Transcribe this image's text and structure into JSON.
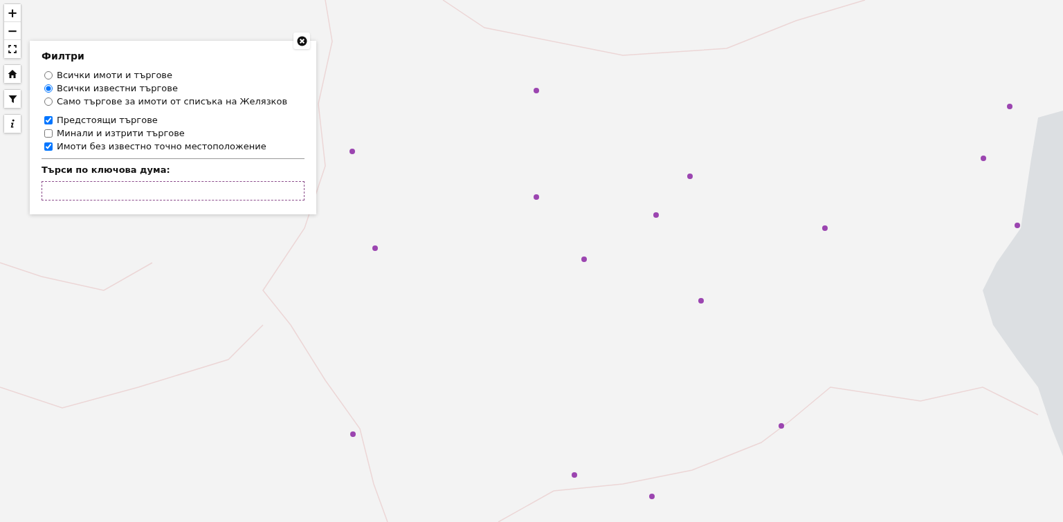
{
  "map_controls": [
    {
      "kind": "zoom_in",
      "label": "+"
    },
    {
      "kind": "zoom_out",
      "label": "−"
    },
    {
      "kind": "fullscreen"
    },
    {
      "kind": "home"
    },
    {
      "kind": "filter"
    },
    {
      "kind": "info"
    }
  ],
  "filter_panel": {
    "title": "Филтри",
    "scope_options": [
      {
        "label": "Всички имоти и търгове",
        "selected": false
      },
      {
        "label": "Всички известни търгове",
        "selected": true
      },
      {
        "label": "Само търгове за имоти от списъка на Желязков",
        "selected": false
      }
    ],
    "toggles": [
      {
        "label": "Предстоящи търгове",
        "checked": true
      },
      {
        "label": "Минали и изтрити търгове",
        "checked": false
      },
      {
        "label": "Имоти без известно точно местоположение",
        "checked": true
      }
    ],
    "search_label": "Търси по ключова дума:"
  }
}
